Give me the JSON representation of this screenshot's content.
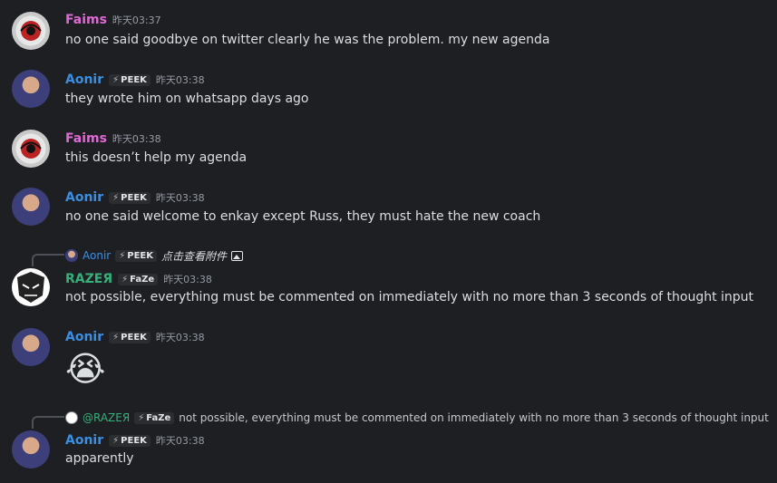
{
  "messages": [
    {
      "author": "Faims",
      "time": "昨天03:37",
      "text": "no one said goodbye on twitter clearly he was the problem. my new agenda"
    },
    {
      "author": "Aonir",
      "tag": "PEEK",
      "time": "昨天03:38",
      "text": "they wrote him on whatsapp days ago"
    },
    {
      "author": "Faims",
      "time": "昨天03:38",
      "text": "this doesn’t help my agenda"
    },
    {
      "author": "Aonir",
      "tag": "PEEK",
      "time": "昨天03:38",
      "text": "no one said welcome to enkay except Russ, they must hate the new coach"
    },
    {
      "author": "RAZEЯ",
      "tag": "FaZe",
      "time": "昨天03:38",
      "text": "not possible, everything must be commented on immediately with no more than 3 seconds of thought input",
      "reply": {
        "author": "Aonir",
        "tag": "PEEK",
        "text": "点击查看附件",
        "icon": "image-icon"
      }
    },
    {
      "author": "Aonir",
      "tag": "PEEK",
      "time": "昨天03:38",
      "emoji": "😭"
    },
    {
      "author": "Aonir",
      "tag": "PEEK",
      "time": "昨天03:38",
      "text": "apparently",
      "reply": {
        "author": "@RAZEЯ",
        "tag": "FaZe",
        "text": "not possible, everything must be commented on immediately with no more than 3 seconds of thought input"
      }
    }
  ],
  "colors": {
    "background": "#1e1f22",
    "faims": "#e06ad5",
    "aonir": "#3b8fe3",
    "razer": "#35b07a"
  }
}
